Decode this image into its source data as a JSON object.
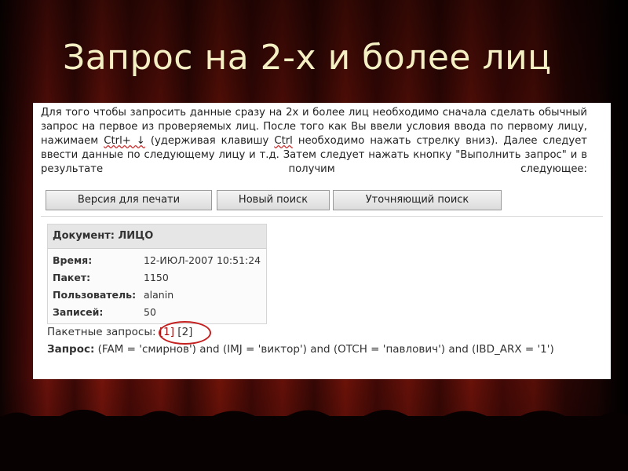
{
  "slide": {
    "title": "Запрос на 2-х и более лиц"
  },
  "instructions": {
    "part1": "Для того чтобы запросить данные сразу на 2х и более лиц необходимо сначала сделать обычный запрос на первое из проверяемых лиц. После того как Вы ввели условия ввода по первому лицу, нажимаем ",
    "key1": "Ctrl+ ↓",
    "part2": " (удерживая клавишу ",
    "key2": "Ctrl",
    "part3": " необходимо нажать стрелку вниз). Далее следует ввести данные по следующему лицу и т.д. Затем следует нажать кнопку \"Выполнить запрос\" и в результате получим следующее:"
  },
  "toolbar": {
    "print_label": "Версия для печати",
    "new_search_label": "Новый поиск",
    "refine_label": "Уточняющий поиск"
  },
  "document": {
    "heading": "Документ: ЛИЦО",
    "rows": [
      {
        "key": "Время:",
        "value": "12-ИЮЛ-2007 10:51:24"
      },
      {
        "key": "Пакет:",
        "value": "1150"
      },
      {
        "key": "Пользователь:",
        "value": "alanin"
      },
      {
        "key": "Записей:",
        "value": "50"
      }
    ]
  },
  "batch": {
    "label": "Пакетные запросы:",
    "link1": "[1]",
    "link2": "[2]"
  },
  "query": {
    "label": "Запрос:",
    "text": " (FAM = 'смирнов') and (IMJ = 'виктор') and (OTCH = 'павлович') and (IBD_ARX = '1')"
  }
}
